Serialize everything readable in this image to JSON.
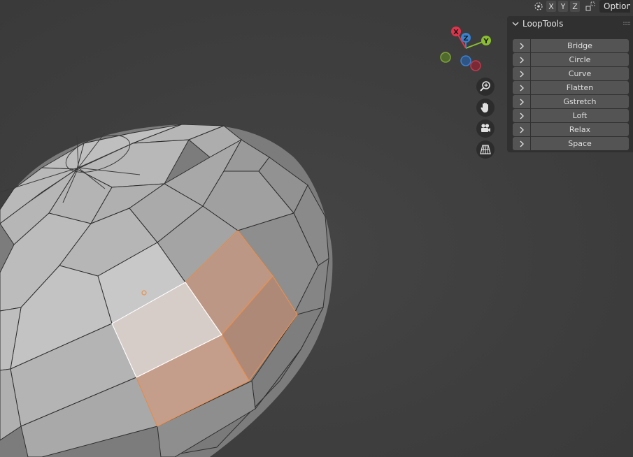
{
  "header": {
    "overlay_icon": "overlay-icon",
    "axis_x": "X",
    "axis_y": "Y",
    "axis_z": "Z",
    "mirror_icon": "mirror-icon",
    "options_label": "Options"
  },
  "gizmo": {
    "x_label": "X",
    "y_label": "Y",
    "z_label": "Z",
    "colors": {
      "x": "#e2334b",
      "y": "#8bbf30",
      "z": "#3a82d1"
    }
  },
  "nav_buttons": [
    {
      "icon": "zoom-icon"
    },
    {
      "icon": "hand-pan-icon"
    },
    {
      "icon": "camera-icon"
    },
    {
      "icon": "grid-perspective-icon"
    }
  ],
  "loop_tools": {
    "title": "LoopTools",
    "buttons": [
      "Bridge",
      "Circle",
      "Curve",
      "Flatten",
      "Gstretch",
      "Loft",
      "Relax",
      "Space"
    ]
  },
  "mesh": {
    "selection_color": "#e89050",
    "face_color": "#b4b4b4"
  }
}
